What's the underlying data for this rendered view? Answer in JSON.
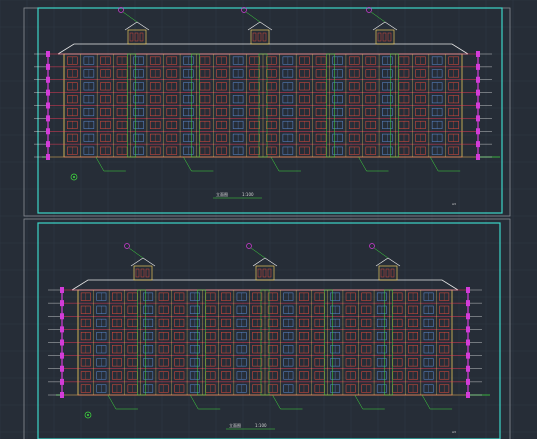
{
  "colors": {
    "background": "#262d37",
    "grid": "#303945",
    "frame": "#3cd6c8",
    "sheet_border": "#8a8f96",
    "facade_outline": "#e7c65a",
    "window_red": "#d84a3c",
    "window_blue": "#5a86c8",
    "floor_line": "#e33b55",
    "dimension_magenta": "#d33cd8",
    "leader_green": "#3fdc3f",
    "roof_white": "#e8e8e8",
    "text": "#d8d8d8"
  },
  "sheets": [
    {
      "id": "elevation-top",
      "title": "立面图",
      "scale": "1:100",
      "stamp": "A3"
    },
    {
      "id": "elevation-bottom",
      "title": "立面图",
      "scale": "1:100",
      "stamp": "A3"
    }
  ]
}
